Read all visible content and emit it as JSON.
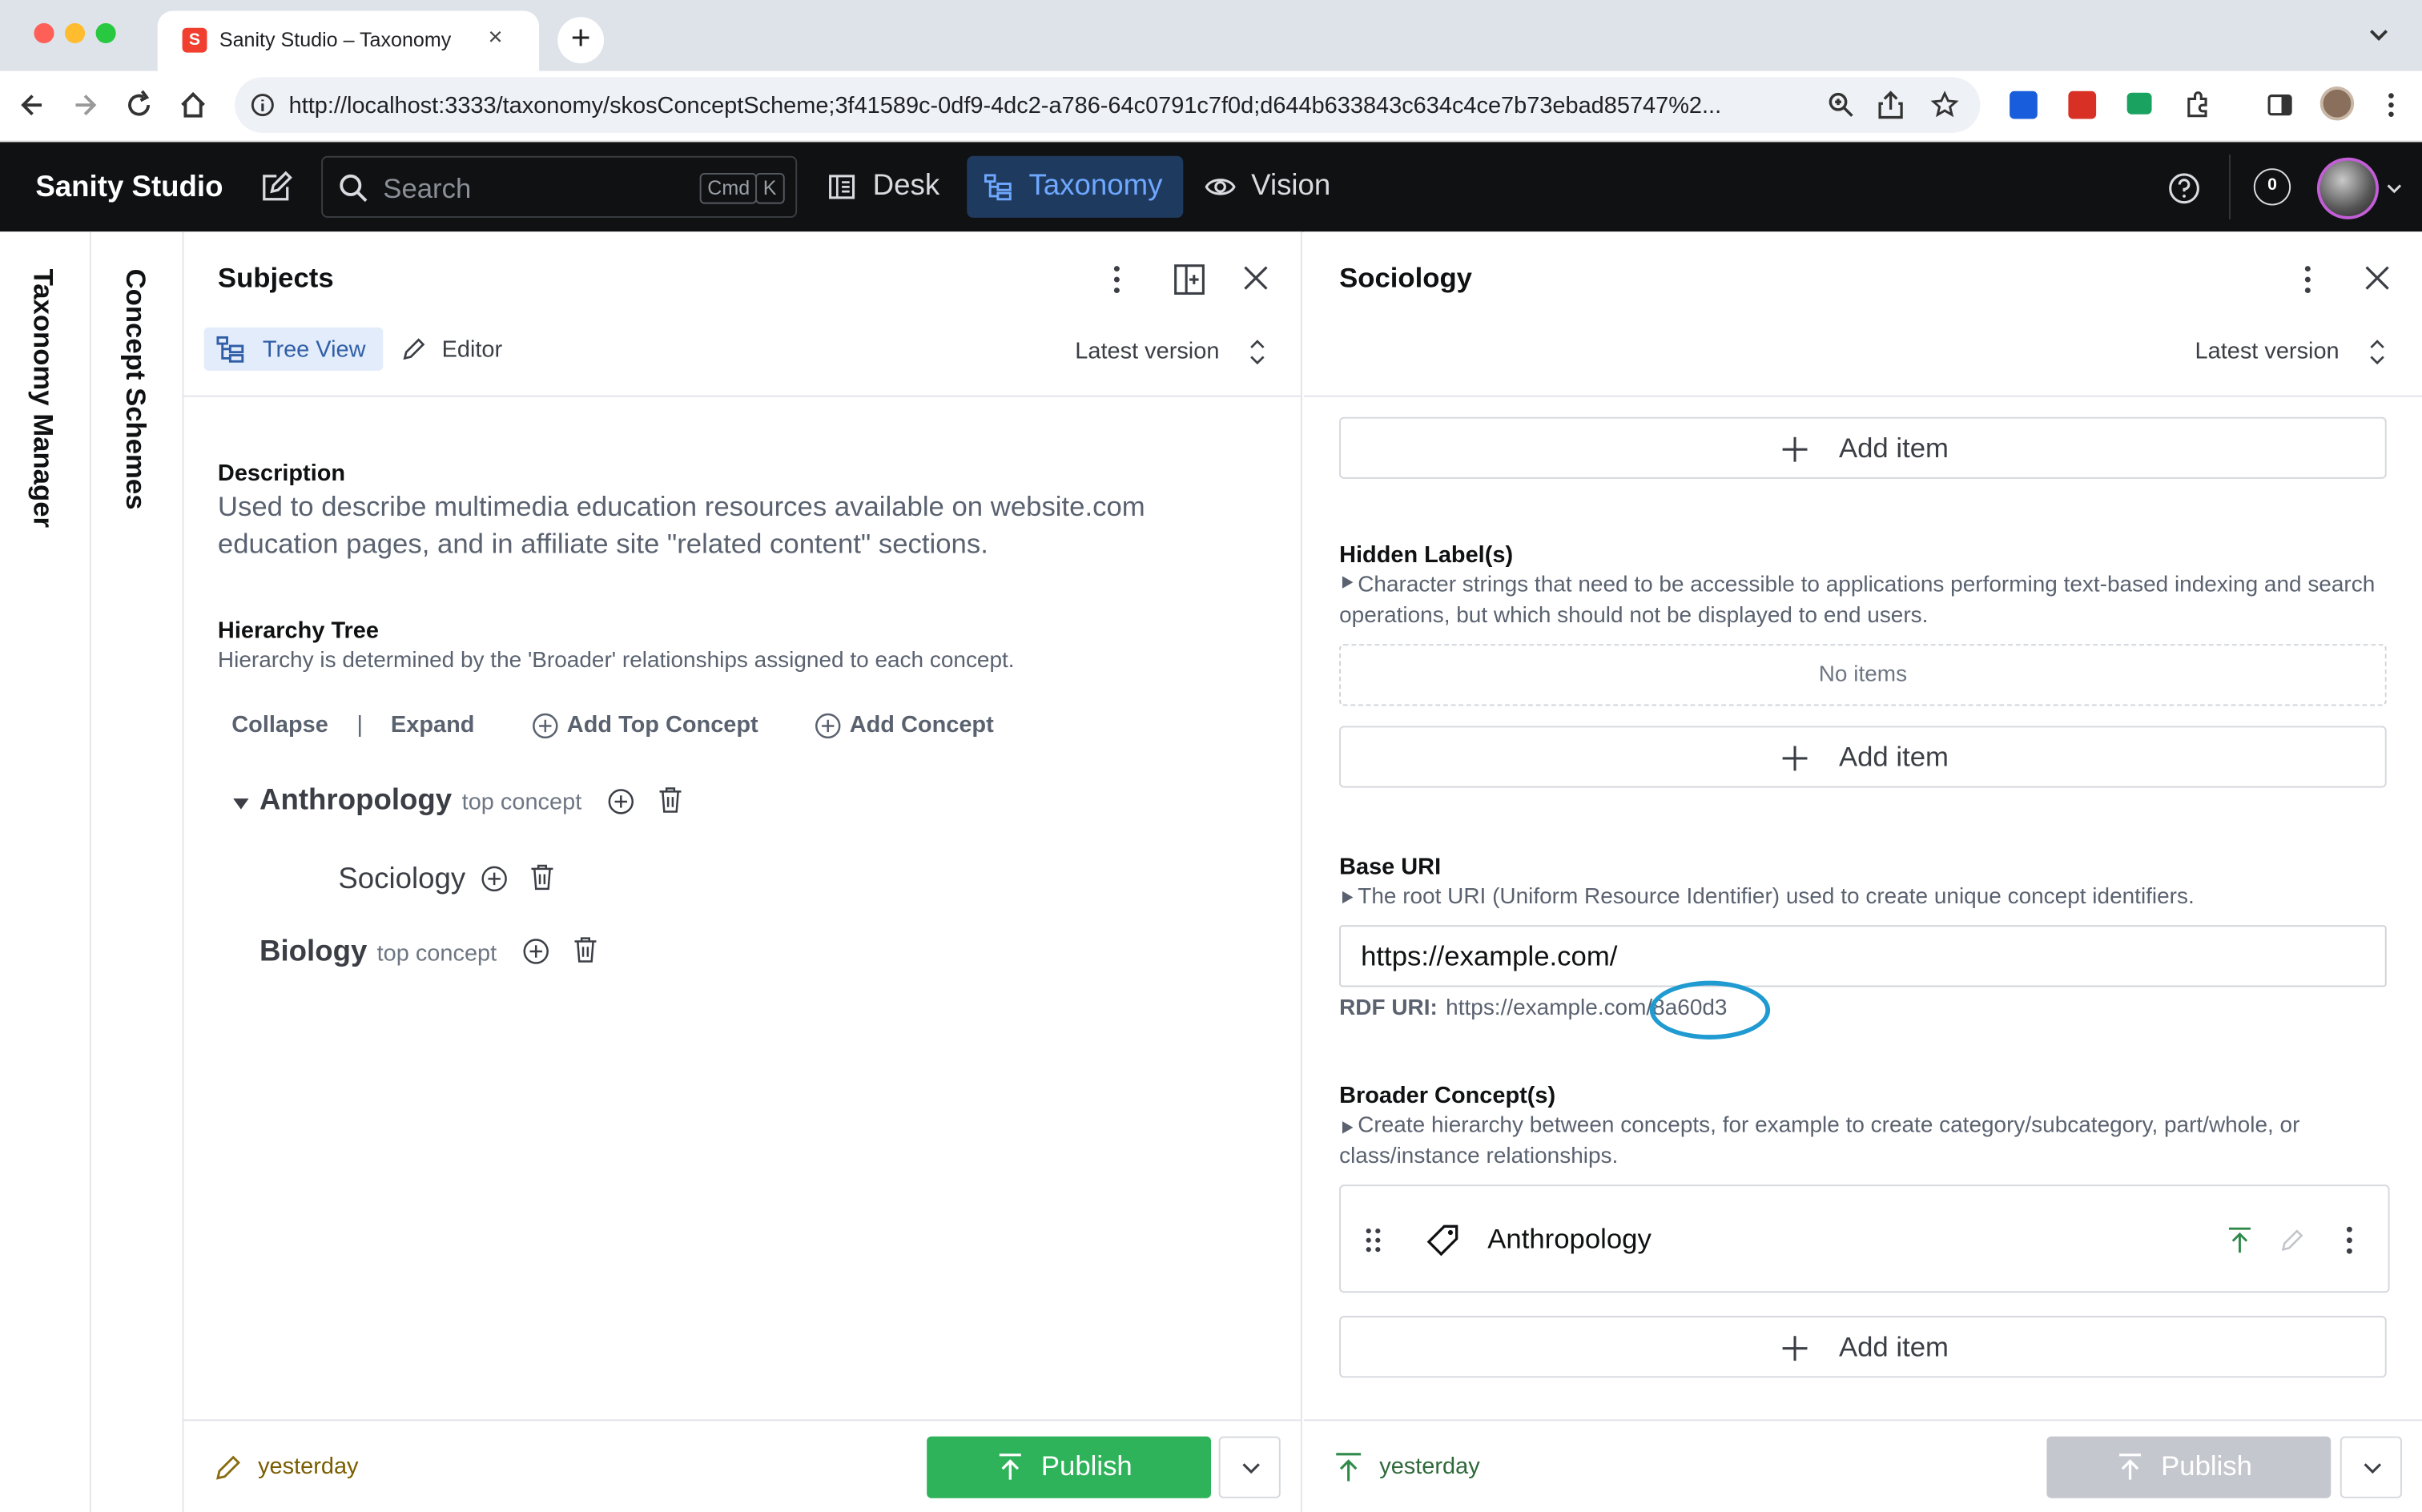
{
  "browser": {
    "tab_title": "Sanity Studio – Taxonomy",
    "tab_favicon": "S",
    "url": "http://localhost:3333/taxonomy/skosConceptScheme;3f41589c-0df9-4dc2-a786-64c0791c7f0d;d644b633843c634c4ce7b73ebad85747%2..."
  },
  "navbar": {
    "brand": "Sanity Studio",
    "search_placeholder": "Search",
    "kbd_cmd": "Cmd",
    "kbd_k": "K",
    "items": [
      {
        "label": "Desk",
        "icon": "desk-icon",
        "active": false
      },
      {
        "label": "Taxonomy",
        "icon": "tree-icon",
        "active": true
      },
      {
        "label": "Vision",
        "icon": "eye-icon",
        "active": false
      }
    ],
    "notifications_count": "0"
  },
  "rails": {
    "taxonomy_manager": "Taxonomy Manager",
    "concept_schemes": "Concept Schemes"
  },
  "left_pane": {
    "title": "Subjects",
    "tab_tree": "Tree View",
    "tab_editor": "Editor",
    "version": "Latest version",
    "description_label": "Description",
    "description_text": "Used to describe multimedia education resources available on website.com education pages, and in affiliate site \"related content\" sections.",
    "hierarchy_label": "Hierarchy Tree",
    "hierarchy_desc": "Hierarchy is determined by the 'Broader' relationships assigned to each concept.",
    "collapse": "Collapse",
    "separator": "|",
    "expand": "Expand",
    "add_top_concept": "Add Top Concept",
    "add_concept": "Add Concept",
    "tree": [
      {
        "label": "Anthropology",
        "tag": "top concept"
      },
      {
        "label": "Sociology",
        "tag": ""
      },
      {
        "label": "Biology",
        "tag": "top concept"
      }
    ],
    "footer_status": "yesterday",
    "publish": "Publish"
  },
  "right_pane": {
    "title": "Sociology",
    "version": "Latest version",
    "add_item": "Add item",
    "hidden_label_title": "Hidden Label(s)",
    "hidden_label_desc": "Character strings that need to be accessible to applications performing text-based indexing and search operations, but which should not be displayed to end users.",
    "no_items": "No items",
    "base_uri_title": "Base URI",
    "base_uri_desc": "The root URI (Uniform Resource Identifier) used to create unique concept identifiers.",
    "base_uri_value": "https://example.com/",
    "rdf_uri_label": "RDF URI:",
    "rdf_uri_value": "https://example.com/8a60d3",
    "broader_title": "Broader Concept(s)",
    "broader_desc": "Create hierarchy between concepts, for example to create category/subcategory, part/whole, or class/instance relationships.",
    "broader_item": "Anthropology",
    "footer_status": "yesterday",
    "publish": "Publish"
  },
  "colors": {
    "publish_green": "#2fb35a",
    "publish_disabled": "#c4c8ce",
    "annotation_circle": "#1f9bd1",
    "nav_active_bg": "#1f3a5f"
  }
}
